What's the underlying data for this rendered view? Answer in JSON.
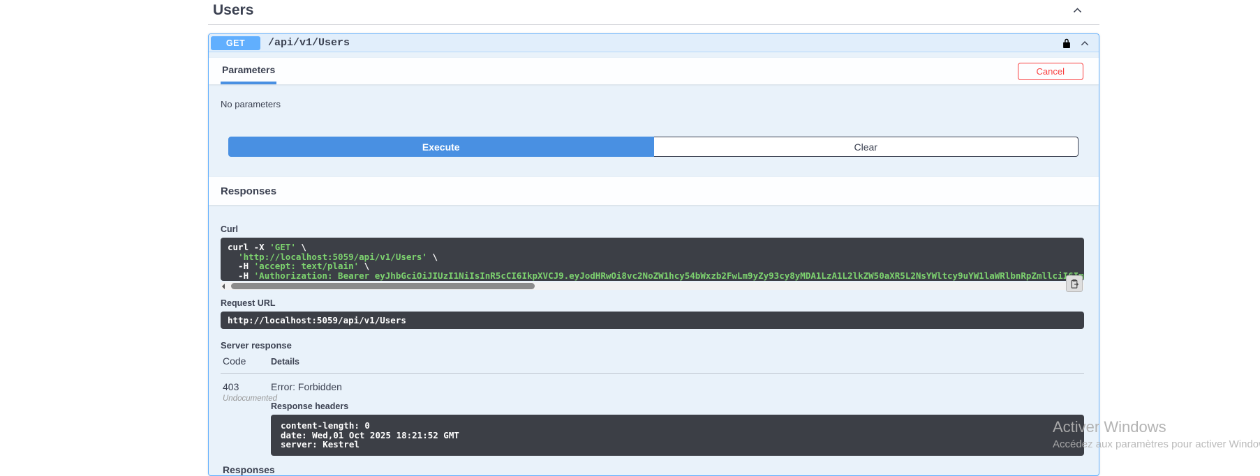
{
  "tag": {
    "title": "Users"
  },
  "operation": {
    "method": "GET",
    "path": "/api/v1/Users",
    "params_tab": "Parameters",
    "cancel": "Cancel",
    "no_parameters": "No parameters",
    "execute": "Execute",
    "clear": "Clear",
    "responses_title": "Responses"
  },
  "curl": {
    "label": "Curl",
    "lines": [
      [
        {
          "t": "curl -X ",
          "c": "k"
        },
        {
          "t": "'GET'",
          "c": "s"
        },
        {
          "t": " \\",
          "c": "k"
        }
      ],
      [
        {
          "t": "  ",
          "c": "k"
        },
        {
          "t": "'http://localhost:5059/api/v1/Users'",
          "c": "s"
        },
        {
          "t": " \\",
          "c": "k"
        }
      ],
      [
        {
          "t": "  -H ",
          "c": "k"
        },
        {
          "t": "'accept: text/plain'",
          "c": "s"
        },
        {
          "t": " \\",
          "c": "k"
        }
      ],
      [
        {
          "t": "  -H ",
          "c": "k"
        },
        {
          "t": "'Authorization: Bearer eyJhbGciOiJIUzI1NiIsInR5cCI6IkpXVCJ9.eyJodHRwOi8vc2NoZW1hcy54bWxzb2FwLm9yZy93cy8yMDA1LzA1L2lkZW50aXR5L2NsYWltcy9uYW1laWRlbnRpZmllciI6ImFlMjgzZDRkLWMzNTItNDM3YS1iNmI5LWE3NWE0ZjM3MzA",
          "c": "s"
        }
      ]
    ]
  },
  "request_url": {
    "label": "Request URL",
    "value": "http://localhost:5059/api/v1/Users"
  },
  "server_response": {
    "label": "Server response",
    "columns": {
      "code": "Code",
      "details": "Details"
    },
    "code": "403",
    "code_note": "Undocumented",
    "error_text": "Error: Forbidden",
    "response_headers_label": "Response headers",
    "response_headers": [
      "content-length: 0",
      "date: Wed,01 Oct 2025 18:21:52 GMT",
      "server: Kestrel"
    ]
  },
  "responses_doc_title": "Responses",
  "watermark": {
    "line1": "Activer Windows",
    "line2": "Accédez aux paramètres pour activer Windows"
  },
  "colors": {
    "accent_blue": "#61affe",
    "execute_blue": "#4990e2",
    "cancel_red": "#f93e3e",
    "code_block_bg": "#3c3f46",
    "string_green": "#7dd36f"
  }
}
